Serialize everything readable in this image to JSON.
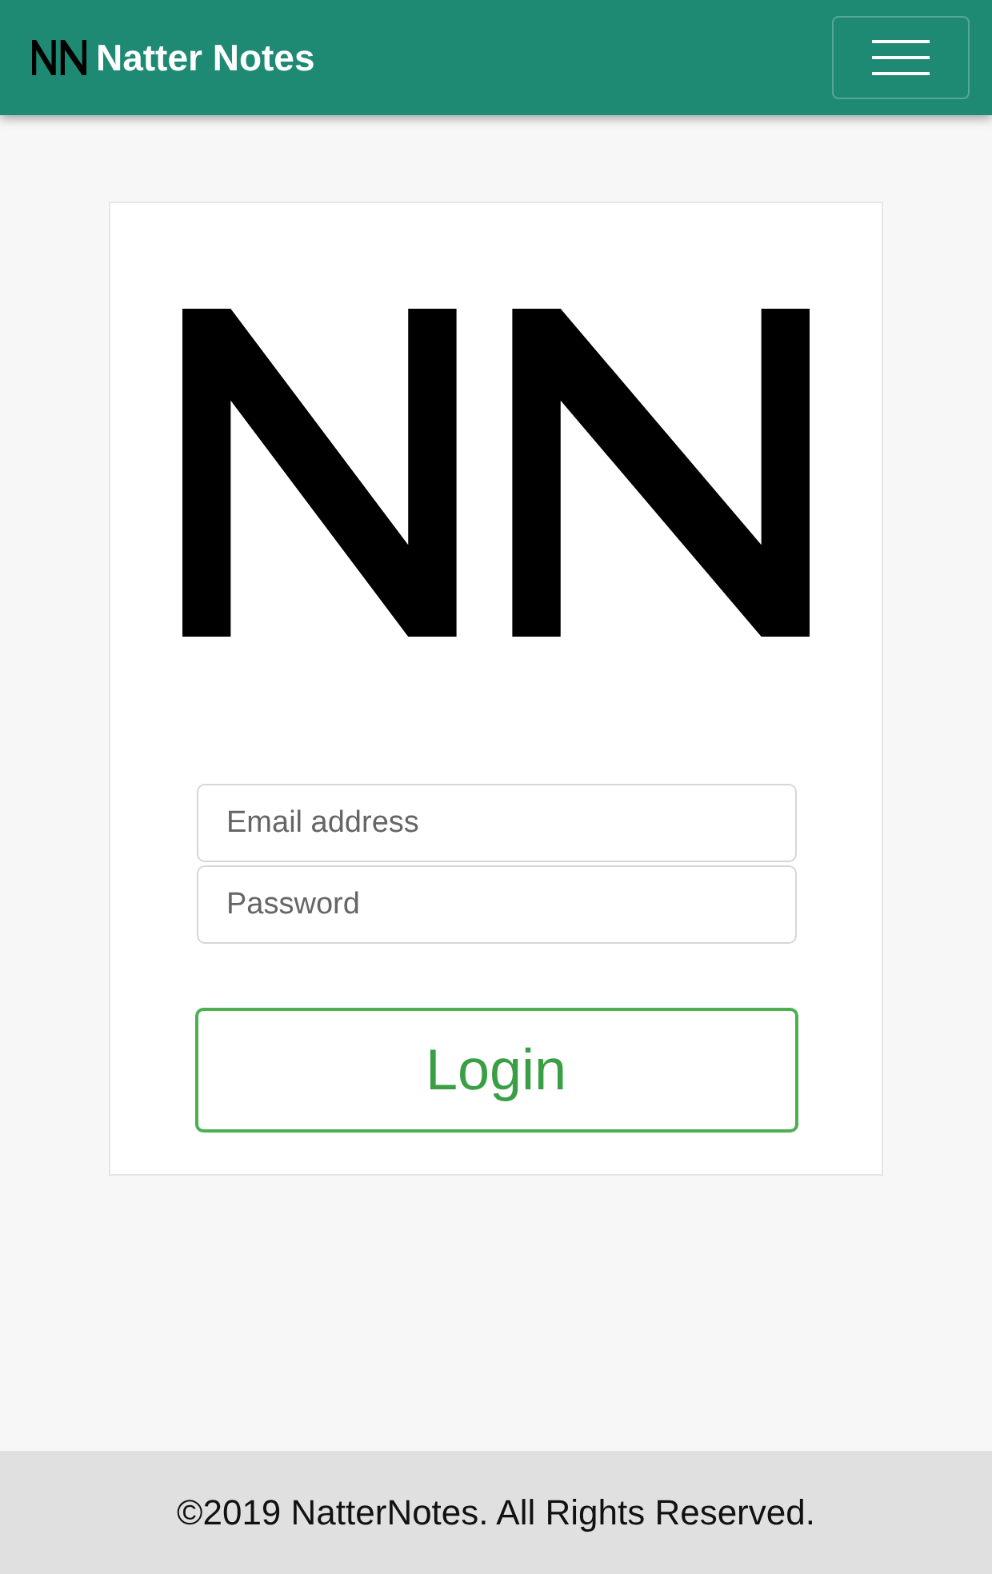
{
  "navbar": {
    "brand": "Natter Notes"
  },
  "login_form": {
    "email": {
      "placeholder": "Email address"
    },
    "password": {
      "placeholder": "Password"
    },
    "submit": "Login"
  },
  "footer": {
    "text": "©2019 NatterNotes. All Rights Reserved."
  }
}
